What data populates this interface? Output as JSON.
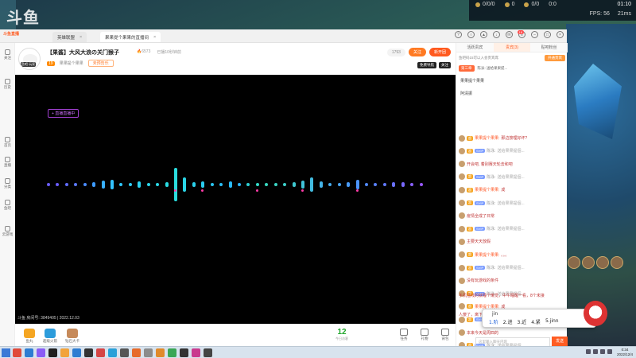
{
  "game": {
    "logo": "斗鱼",
    "hud": {
      "kills": "0/0/0",
      "cs": "0",
      "gold": "0/0",
      "fps_label": "FPS:",
      "fps_value": "56",
      "ping": "21ms",
      "time": "01:10",
      "score": "0:0"
    }
  },
  "browser": {
    "app_logo": "斗鱼直播",
    "tabs": [
      {
        "label": "英雄联盟"
      },
      {
        "label": "果果提个果果的直播间"
      }
    ],
    "notification_count": "18"
  },
  "sidebar": {
    "items": [
      {
        "label": "关注"
      },
      {
        "label": "历史"
      },
      {
        "label": "首页"
      },
      {
        "label": "直播"
      },
      {
        "label": "分类"
      },
      {
        "label": "鱼吧"
      },
      {
        "label": "云游戏"
      }
    ]
  },
  "room": {
    "avatar_label": "鱼吧 玩家",
    "title": "【果酱】大风大浪の关门猴子",
    "hot": "6573",
    "status": "已播10秒钟前",
    "anchor_level": "19",
    "anchor_name": "果果提个果果",
    "tag_text": "未预告乐",
    "follow_count": "1793",
    "follow_label": "关注",
    "subscribe_label": "新开团",
    "extra_tags": [
      "免费导航",
      "关注"
    ]
  },
  "player": {
    "float_tag": "+ 直播直播中",
    "footer": "斗鱼 房间号: 3849405 | 2022.12.03",
    "viz_bars": [
      {
        "h": 4,
        "c": "#6a5cff"
      },
      {
        "h": 4,
        "c": "#6a5cff"
      },
      {
        "h": 4,
        "c": "#5f6cff"
      },
      {
        "h": 4,
        "c": "#5a78ff"
      },
      {
        "h": 4,
        "c": "#4a8cff"
      },
      {
        "h": 6,
        "c": "#3d9bff"
      },
      {
        "h": 10,
        "c": "#38b0ff"
      },
      {
        "h": 12,
        "c": "#33c2ff"
      },
      {
        "h": 4,
        "c": "#2ec8ff"
      },
      {
        "h": 4,
        "c": "#2ecaf6"
      },
      {
        "h": 8,
        "c": "#2cd2f0"
      },
      {
        "h": 4,
        "c": "#2ad6ea"
      },
      {
        "h": 4,
        "c": "#2ad8e6"
      },
      {
        "h": 6,
        "c": "#2adbe2"
      },
      {
        "h": 42,
        "c": "#2adcde"
      },
      {
        "h": 18,
        "c": "#2ad5e6"
      },
      {
        "h": 6,
        "c": "#2ad0ea"
      },
      {
        "h": 8,
        "c": "#2acbee"
      },
      {
        "h": 4,
        "c": "#2ac6f2"
      },
      {
        "h": 4,
        "c": "#2ac0f6"
      },
      {
        "h": 8,
        "c": "#2abafa"
      },
      {
        "h": 4,
        "c": "#2ab4fe"
      },
      {
        "h": 4,
        "c": "#2ed0d4"
      },
      {
        "h": 4,
        "c": "#33dac8"
      },
      {
        "h": 4,
        "c": "#38d8c0"
      },
      {
        "h": 4,
        "c": "#3ad4c4"
      },
      {
        "h": 4,
        "c": "#3ccfca"
      },
      {
        "h": 6,
        "c": "#3ec8d0"
      },
      {
        "h": 10,
        "c": "#40c2d8"
      },
      {
        "h": 18,
        "c": "#42bce0"
      },
      {
        "h": 8,
        "c": "#44b4e8"
      },
      {
        "h": 4,
        "c": "#46acf0"
      },
      {
        "h": 4,
        "c": "#48a4f6"
      },
      {
        "h": 6,
        "c": "#4a9cfa"
      },
      {
        "h": 12,
        "c": "#4c94fc"
      },
      {
        "h": 4,
        "c": "#5088fc"
      },
      {
        "h": 4,
        "c": "#5880fc"
      },
      {
        "h": 4,
        "c": "#6078fc"
      },
      {
        "h": 6,
        "c": "#6a70fc"
      },
      {
        "h": 6,
        "c": "#7868fc"
      },
      {
        "h": 4,
        "c": "#8860fc"
      },
      {
        "h": 4,
        "c": "#9858fc"
      }
    ],
    "viz_dots": [
      14,
      17,
      23,
      28,
      34
    ]
  },
  "bottom": {
    "gifts": [
      {
        "label": "鱼丸",
        "color": "#f5a623"
      },
      {
        "label": "超级火箭",
        "color": "#2d9cdb"
      },
      {
        "label": "钻石大卡",
        "color": "#c68a5a"
      }
    ],
    "online_count": "12",
    "online_label": "今日访客",
    "right": [
      {
        "label": "任务"
      },
      {
        "label": "礼物"
      },
      {
        "label": "背包"
      }
    ]
  },
  "chat": {
    "tabs": [
      {
        "label": "活跃贵宾",
        "active": false
      },
      {
        "label": "贵宾(3)",
        "active": true
      },
      {
        "label": "贴吧粉丝",
        "active": false
      }
    ],
    "notice": "鱼吧码15可以入会贵宾席",
    "join_label": "开通贵宾",
    "rank_badge": "第三章",
    "rank_text": "陈泳: 送给果果提...",
    "plain_lines": [
      "果果提个果果",
      "阿清振"
    ],
    "messages": [
      {
        "lv": "超",
        "lv2": "",
        "name": "果果提个果果:",
        "text": "那边按理好坏?",
        "sys": false
      },
      {
        "lv": "超",
        "lv2": "SVIP",
        "name": "陈泳:",
        "text": "送给果果提個...",
        "sys": true
      },
      {
        "lv": "",
        "lv2": "",
        "name": "",
        "text": "开会吧, 着别赛天轮去和吧",
        "sys": false
      },
      {
        "lv": "超",
        "lv2": "SVIP",
        "name": "陈泳:",
        "text": "送给果果提個...",
        "sys": true
      },
      {
        "lv": "超",
        "lv2": "",
        "name": "果果提个果果:",
        "text": "成",
        "sys": false
      },
      {
        "lv": "超",
        "lv2": "SVIP",
        "name": "陈泳:",
        "text": "送给果果提個...",
        "sys": true
      },
      {
        "lv": "",
        "lv2": "",
        "name": "",
        "text": "疫情全成了日常",
        "sys": false
      },
      {
        "lv": "超",
        "lv2": "SVIP",
        "name": "陈泳:",
        "text": "送给果果提個...",
        "sys": true
      },
      {
        "lv": "",
        "lv2": "",
        "name": "",
        "text": "主要天天放假",
        "sys": false
      },
      {
        "lv": "超",
        "lv2": "",
        "name": "果果提个果果:",
        "text": "。。。",
        "sys": false
      },
      {
        "lv": "超",
        "lv2": "SVIP",
        "name": "陈泳:",
        "text": "送给果果提個...",
        "sys": true
      },
      {
        "lv": "",
        "lv2": "",
        "name": "",
        "text": "没有玩游戏的条件",
        "sys": false
      },
      {
        "lv": "超",
        "lv2": "SVIP",
        "name": "陈泳:",
        "text": "送给果果提個...",
        "sys": true
      },
      {
        "lv": "超",
        "lv2": "",
        "name": "果果提个果果:",
        "text": "成",
        "sys": false
      },
      {
        "lv": "超",
        "lv2": "SVIP",
        "name": "陈泳:",
        "text": "送给果果提個...",
        "sys": true
      },
      {
        "lv": "",
        "lv2": "",
        "name": "",
        "text": "本来今天是周四的",
        "sys": false
      },
      {
        "lv": "超",
        "lv2": "SVIP",
        "name": "陈泳:",
        "text": "送给果果提個...",
        "sys": true
      }
    ],
    "wrap_lines": [
      "手机插线的就睡个懒觉，中午睡醒一看，8个未接",
      "人傻了，离下午还休息个环，冠都回家上班了"
    ],
    "input_placeholder": "这里输入聊天内容",
    "send_label": "发送"
  },
  "ime": {
    "composition": "jin",
    "candidates": [
      "1.阶",
      "2.进",
      "3.近",
      "4.紧",
      "5.jinn"
    ]
  },
  "taskbar": {
    "time": "0:34",
    "date": "2022/12/4"
  }
}
